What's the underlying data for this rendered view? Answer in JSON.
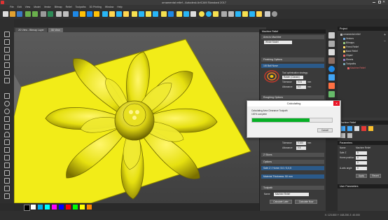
{
  "window": {
    "title": "ornamental relief - Autodesk ArtCAM Standard 2017"
  },
  "menu": [
    "File",
    "Edit",
    "View",
    "Model",
    "Vector",
    "Bitmap",
    "Relief",
    "Toolpaths",
    "3D Printing",
    "Window",
    "Help"
  ],
  "viewport_tabs": [
    {
      "label": "2D View - Bitmap Layer"
    },
    {
      "label": "3D View"
    }
  ],
  "machine_relief_panel": {
    "header": "Machine Relief",
    "area_section": "Area to Machine",
    "area_value": "Whole Model",
    "finishing_section": "Finishing Options",
    "finishing_tool_value": "1/8 Ball Nose",
    "tool_overlap_label": "Tool optimisation strategy:",
    "strategy_value": "Raster (Classic)",
    "tolerance_label": "Tolerance",
    "tolerance_value": "0.01",
    "tolerance_unit": "mm",
    "allowance_label": "Allowance",
    "allowance_value": "0.0",
    "allowance_unit": "mm",
    "roughing_section": "Roughing Options",
    "tolerance2_label": "Tolerance",
    "tolerance2_value": "0.100",
    "tolerance2_unit": "mm",
    "allowance2_label": "Allowance",
    "allowance2_value": "0.5",
    "z_slices_label": "Z Slices",
    "options_section": "Options",
    "safe_z_label": "Safe Z / Home: 5.0 / 0,0,5",
    "material_label": "Material Thickness: 50 mm",
    "toolpath_section": "Toolpath",
    "name_label": "Name",
    "name_value": "Machine Relief",
    "calc_later_button": "Calculate Later",
    "calc_now_button": "Calculate Now"
  },
  "dialog": {
    "title": "Calculating",
    "message": "Calculating Area Clearance Toolpath",
    "percent_text": "100% complete",
    "progress": 0.72,
    "cancel_label": "Cancel"
  },
  "project_panel": {
    "header": "Project",
    "items": [
      {
        "label": "ornamental relief",
        "color": "#bbbbbb"
      },
      {
        "label": "Vectors",
        "color": "#6fa8dc"
      },
      {
        "label": "Bitmaps",
        "color": "#93c47d"
      },
      {
        "label": "Freed Relief",
        "color": "#ffd966"
      },
      {
        "label": "Back Relief",
        "color": "#ffd966"
      },
      {
        "label": "Clipart",
        "color": "#e06666"
      },
      {
        "label": "Sheets",
        "color": "#8e7cc3"
      },
      {
        "label": "Toolpaths",
        "color": "#76a5af"
      },
      {
        "label": "Machine Relief",
        "color": "#e06666"
      }
    ]
  },
  "relief_panel": {
    "header": "Machine Relief",
    "parameters_header": "Parameters",
    "rows": [
      {
        "label": "Name",
        "value": "Machine Relief"
      },
      {
        "label": "Safe Z",
        "value": "5"
      },
      {
        "label": "Home position",
        "value": "0"
      },
      {
        "label": "",
        "value": "0"
      },
      {
        "label": "A-axis angle",
        "value": "0"
      }
    ],
    "apply_label": "Apply",
    "revert_label": "Revert",
    "user_params_header": "User Parameters"
  },
  "status": {
    "coords": "X: 123.800   Y: 168.250   Z: 40.000"
  },
  "colors": {
    "relief": "#e6e010",
    "accent": "#1e5fa8",
    "progress": "#06b025",
    "swatches": [
      "#000000",
      "#ffffff",
      "#00b0f0",
      "#00ffff",
      "#ff00ff",
      "#0000ff",
      "#ff0000",
      "#00ff00",
      "#ffff00",
      "#ff8800"
    ]
  }
}
